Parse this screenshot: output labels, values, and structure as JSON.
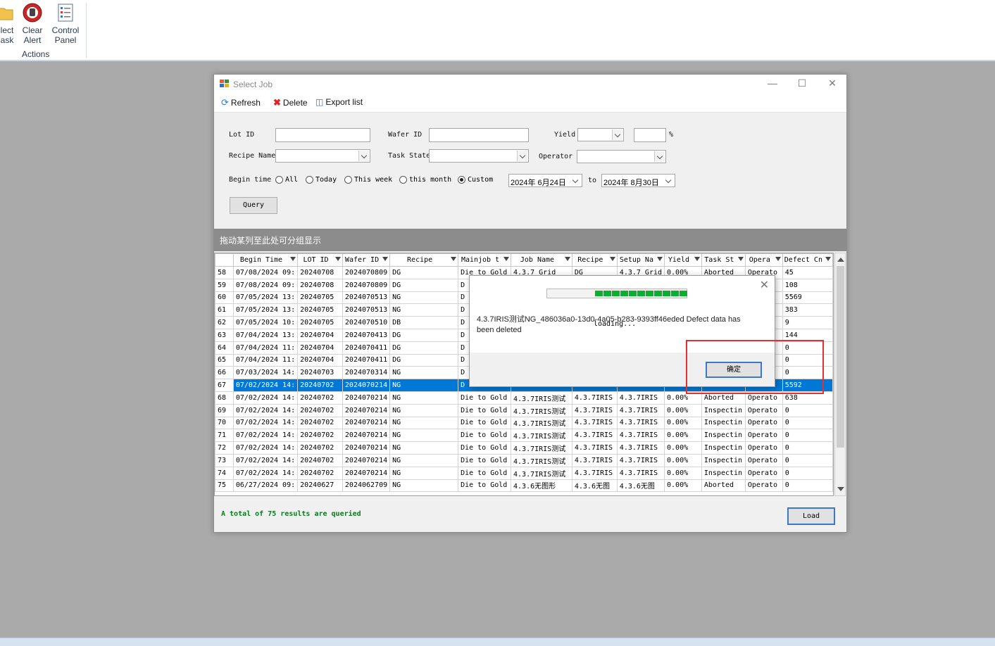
{
  "ribbon": {
    "buttons": [
      {
        "label1": "lect",
        "label2": "ask",
        "icon": "folder-icon"
      },
      {
        "label1": "Clear",
        "label2": "Alert",
        "icon": "stop-alert-icon"
      },
      {
        "label1": "Control",
        "label2": "Panel",
        "icon": "control-panel-icon"
      }
    ],
    "group_label": "Actions"
  },
  "window": {
    "title": "Select Job",
    "toolbar": {
      "refresh": "Refresh",
      "delete": "Delete",
      "export": "Export list"
    },
    "filters": {
      "lot_id_label": "Lot ID",
      "wafer_id_label": "Wafer ID",
      "yield_label": "Yield",
      "percent": "%",
      "recipe_name_label": "Recipe Name",
      "task_state_label": "Task State",
      "operator_label": "Operator",
      "begin_time_label": "Begin time",
      "radios": [
        "All",
        "Today",
        "This week",
        "this month",
        "Custom"
      ],
      "selected_radio": "Custom",
      "from_date": "2024年 6月24日",
      "to_label": "to",
      "to_date": "2024年 8月30日",
      "query_button": "Query"
    },
    "group_hint": "拖动某列至此处可分组显示",
    "columns": [
      "Begin Time",
      "LOT ID",
      "Wafer ID",
      "Recipe",
      "Mainjob t",
      "Job Name",
      "Recipe",
      "Setup Na",
      "Yield",
      "Task St",
      "Opera",
      "Defect Cn"
    ],
    "rows": [
      {
        "n": "58",
        "c": [
          "07/08/2024 09:",
          "20240708",
          "2024070809",
          "DG",
          "Die to Gold",
          "4.3.7_Grid",
          "DG",
          "4.3.7_Grid",
          "0.00%",
          "Aborted",
          "Operato",
          "45"
        ]
      },
      {
        "n": "59",
        "c": [
          "07/08/2024 09:",
          "20240708",
          "2024070809",
          "DG",
          "D",
          "",
          "",
          "",
          "",
          "",
          "",
          "108"
        ]
      },
      {
        "n": "60",
        "c": [
          "07/05/2024 13:",
          "20240705",
          "2024070513",
          "NG",
          "D",
          "",
          "",
          "",
          "",
          "",
          "",
          "5569"
        ]
      },
      {
        "n": "61",
        "c": [
          "07/05/2024 13:",
          "20240705",
          "2024070513",
          "NG",
          "D",
          "",
          "",
          "",
          "",
          "",
          "",
          "383"
        ]
      },
      {
        "n": "62",
        "c": [
          "07/05/2024 10:",
          "20240705",
          "2024070510",
          "DB",
          "D",
          "",
          "",
          "",
          "",
          "",
          "",
          "9"
        ]
      },
      {
        "n": "63",
        "c": [
          "07/04/2024 13:",
          "20240704",
          "2024070413",
          "DG",
          "D",
          "",
          "",
          "",
          "",
          "",
          "",
          "144"
        ]
      },
      {
        "n": "64",
        "c": [
          "07/04/2024 11:",
          "20240704",
          "2024070411",
          "DG",
          "D",
          "",
          "",
          "",
          "",
          "",
          "",
          "0"
        ]
      },
      {
        "n": "65",
        "c": [
          "07/04/2024 11:",
          "20240704",
          "2024070411",
          "DG",
          "D",
          "",
          "",
          "",
          "",
          "",
          "",
          "0"
        ]
      },
      {
        "n": "66",
        "c": [
          "07/03/2024 14:",
          "20240703",
          "2024070314",
          "NG",
          "D",
          "",
          "",
          "",
          "",
          "",
          "",
          "0"
        ]
      },
      {
        "n": "67",
        "c": [
          "07/02/2024 14:",
          "20240702",
          "2024070214",
          "NG",
          "D",
          "",
          "",
          "",
          "",
          "",
          "",
          "5592"
        ],
        "selected": true
      },
      {
        "n": "68",
        "c": [
          "07/02/2024 14:",
          "20240702",
          "2024070214",
          "NG",
          "Die to Gold",
          "4.3.7IRIS测试",
          "4.3.7IRIS",
          "4.3.7IRIS",
          "0.00%",
          "Aborted",
          "Operato",
          "638"
        ]
      },
      {
        "n": "69",
        "c": [
          "07/02/2024 14:",
          "20240702",
          "2024070214",
          "NG",
          "Die to Gold",
          "4.3.7IRIS测试",
          "4.3.7IRIS",
          "4.3.7IRIS",
          "0.00%",
          "Inspectin",
          "Operato",
          "0"
        ]
      },
      {
        "n": "70",
        "c": [
          "07/02/2024 14:",
          "20240702",
          "2024070214",
          "NG",
          "Die to Gold",
          "4.3.7IRIS测试",
          "4.3.7IRIS",
          "4.3.7IRIS",
          "0.00%",
          "Inspectin",
          "Operato",
          "0"
        ]
      },
      {
        "n": "71",
        "c": [
          "07/02/2024 14:",
          "20240702",
          "2024070214",
          "NG",
          "Die to Gold",
          "4.3.7IRIS测试",
          "4.3.7IRIS",
          "4.3.7IRIS",
          "0.00%",
          "Inspectin",
          "Operato",
          "0"
        ]
      },
      {
        "n": "72",
        "c": [
          "07/02/2024 14:",
          "20240702",
          "2024070214",
          "NG",
          "Die to Gold",
          "4.3.7IRIS测试",
          "4.3.7IRIS",
          "4.3.7IRIS",
          "0.00%",
          "Inspectin",
          "Operato",
          "0"
        ]
      },
      {
        "n": "73",
        "c": [
          "07/02/2024 14:",
          "20240702",
          "2024070214",
          "NG",
          "Die to Gold",
          "4.3.7IRIS测试",
          "4.3.7IRIS",
          "4.3.7IRIS",
          "0.00%",
          "Inspectin",
          "Operato",
          "0"
        ]
      },
      {
        "n": "74",
        "c": [
          "07/02/2024 14:",
          "20240702",
          "2024070214",
          "NG",
          "Die to Gold",
          "4.3.7IRIS测试",
          "4.3.7IRIS",
          "4.3.7IRIS",
          "0.00%",
          "Inspectin",
          "Operato",
          "0"
        ]
      },
      {
        "n": "75",
        "c": [
          "06/27/2024 09:",
          "20240627",
          "2024062709",
          "NG",
          "Die to Gold",
          "4.3.6无图形",
          "4.3.6无图",
          "4.3.6无图",
          "0.00%",
          "Aborted",
          "Operato",
          "0"
        ]
      }
    ],
    "status": "A total of 75 results are queried",
    "load_button": "Load"
  },
  "dialog": {
    "message": "4.3.7IRIS测试NG_486036a0-13d0-4a05-b283-9393ff46eded Defect data has been deleted",
    "loading": "loading...",
    "ok_button": "确定",
    "progress_segments": 11
  },
  "colors": {
    "selection": "#0078d7",
    "progress": "#08b12c",
    "highlight_box": "#e53030",
    "status_text": "#0a7a1e"
  }
}
